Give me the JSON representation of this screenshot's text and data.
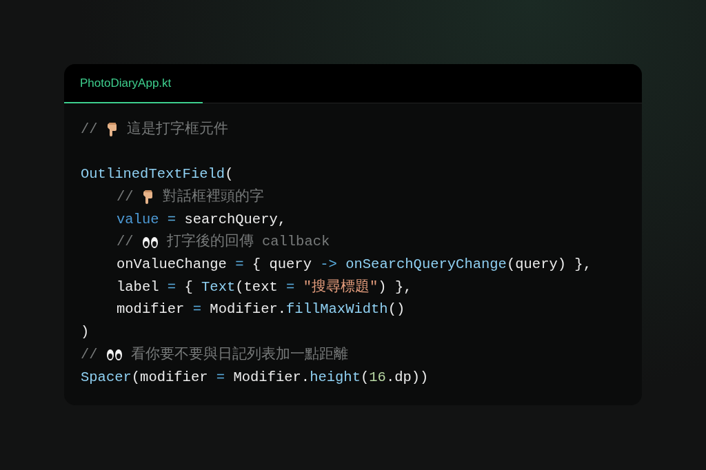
{
  "file_tab": {
    "label": "PhotoDiaryApp.kt",
    "selected": true
  },
  "code": [
    {
      "tokens": [
        {
          "kind": "comment",
          "text": "//"
        },
        {
          "kind": "hand"
        },
        {
          "kind": "comment",
          "text": "這是打字框元件"
        }
      ]
    },
    {
      "kind": "block",
      "tokens": [
        {
          "kind": "func",
          "text": "OutlinedTextField"
        },
        {
          "kind": "plain",
          "text": "("
        }
      ],
      "children": [
        {
          "tokens": [
            {
              "kind": "comment",
              "text": "//"
            },
            {
              "kind": "hand"
            },
            {
              "kind": "comment",
              "text": "對話框裡頭的字"
            }
          ]
        },
        {
          "tokens": [
            {
              "kind": "param",
              "text": "value"
            },
            {
              "kind": "op",
              "text": " = "
            },
            {
              "kind": "plain",
              "text": "searchQuery,"
            }
          ]
        },
        {
          "tokens": [
            {
              "kind": "comment",
              "text": "//"
            },
            {
              "kind": "eyes"
            },
            {
              "kind": "comment",
              "text": "打字後的回傳 callback"
            }
          ]
        },
        {
          "tokens": [
            {
              "kind": "plain",
              "text": "onValueChange"
            },
            {
              "kind": "op",
              "text": " = "
            },
            {
              "kind": "plain",
              "text": "{ query "
            },
            {
              "kind": "op",
              "text": "->"
            },
            {
              "kind": "func",
              "text": " onSearchQueryChange"
            },
            {
              "kind": "plain",
              "text": "(query) },"
            }
          ]
        },
        {
          "tokens": [
            {
              "kind": "plain",
              "text": "label"
            },
            {
              "kind": "op",
              "text": " = "
            },
            {
              "kind": "plain",
              "text": "{ "
            },
            {
              "kind": "func",
              "text": "Text"
            },
            {
              "kind": "plain",
              "text": "(text"
            },
            {
              "kind": "op",
              "text": " = "
            },
            {
              "kind": "string",
              "text": "\"搜尋標題\""
            },
            {
              "kind": "plain",
              "text": ") },"
            }
          ]
        },
        {
          "tokens": [
            {
              "kind": "plain",
              "text": "modifier"
            },
            {
              "kind": "op",
              "text": " = "
            },
            {
              "kind": "plain",
              "text": "Modifier."
            },
            {
              "kind": "func",
              "text": "fillMaxWidth"
            },
            {
              "kind": "plain",
              "text": "()"
            }
          ]
        }
      ]
    },
    {
      "tokens": [
        {
          "kind": "plain",
          "text": ")"
        }
      ]
    },
    {
      "tokens": [
        {
          "kind": "comment",
          "text": "//"
        },
        {
          "kind": "eyes"
        },
        {
          "kind": "comment",
          "text": "看你要不要與日記列表加一點距離"
        }
      ]
    },
    {
      "tokens": [
        {
          "kind": "func",
          "text": "Spacer"
        },
        {
          "kind": "plain",
          "text": "(modifier"
        },
        {
          "kind": "op",
          "text": " = "
        },
        {
          "kind": "plain",
          "text": "Modifier."
        },
        {
          "kind": "func",
          "text": "height"
        },
        {
          "kind": "plain",
          "text": "("
        },
        {
          "kind": "number",
          "text": "16"
        },
        {
          "kind": "plain",
          "text": ".dp))"
        }
      ]
    }
  ]
}
